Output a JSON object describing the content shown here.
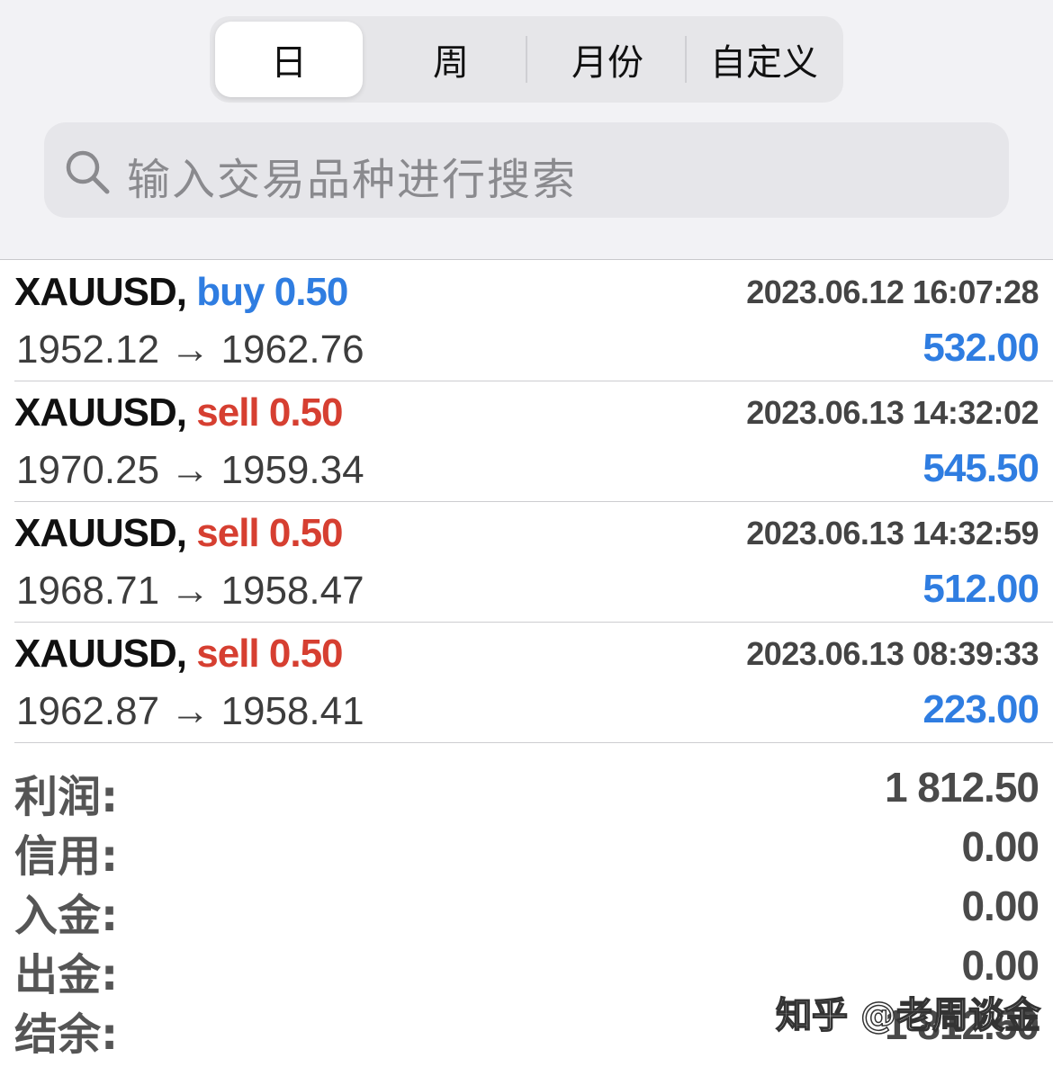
{
  "tabs": [
    {
      "label": "日",
      "active": true
    },
    {
      "label": "周",
      "active": false
    },
    {
      "label": "月份",
      "active": false
    },
    {
      "label": "自定义",
      "active": false
    }
  ],
  "search": {
    "placeholder": "输入交易品种进行搜索",
    "icon": "search-icon"
  },
  "trades": [
    {
      "symbol": "XAUUSD,",
      "side": "buy",
      "volume": "0.50",
      "time": "2023.06.12 16:07:28",
      "prices": "1952.12 → 1962.76",
      "profit": "532.00"
    },
    {
      "symbol": "XAUUSD,",
      "side": "sell",
      "volume": "0.50",
      "time": "2023.06.13 14:32:02",
      "prices": "1970.25 → 1959.34",
      "profit": "545.50"
    },
    {
      "symbol": "XAUUSD,",
      "side": "sell",
      "volume": "0.50",
      "time": "2023.06.13 14:32:59",
      "prices": "1968.71 → 1958.47",
      "profit": "512.00"
    },
    {
      "symbol": "XAUUSD,",
      "side": "sell",
      "volume": "0.50",
      "time": "2023.06.13 08:39:33",
      "prices": "1962.87 → 1958.41",
      "profit": "223.00"
    }
  ],
  "summary": [
    {
      "label": "利润:",
      "value": "1 812.50"
    },
    {
      "label": "信用:",
      "value": "0.00"
    },
    {
      "label": "入金:",
      "value": "0.00"
    },
    {
      "label": "出金:",
      "value": "0.00"
    },
    {
      "label": "结余:",
      "value": "1 812.50"
    }
  ],
  "watermark": "知乎 @老周谈金",
  "colors": {
    "buy": "#2f7de1",
    "sell": "#d63f31",
    "profit": "#2f7de1",
    "header_bg": "#f2f2f5"
  }
}
